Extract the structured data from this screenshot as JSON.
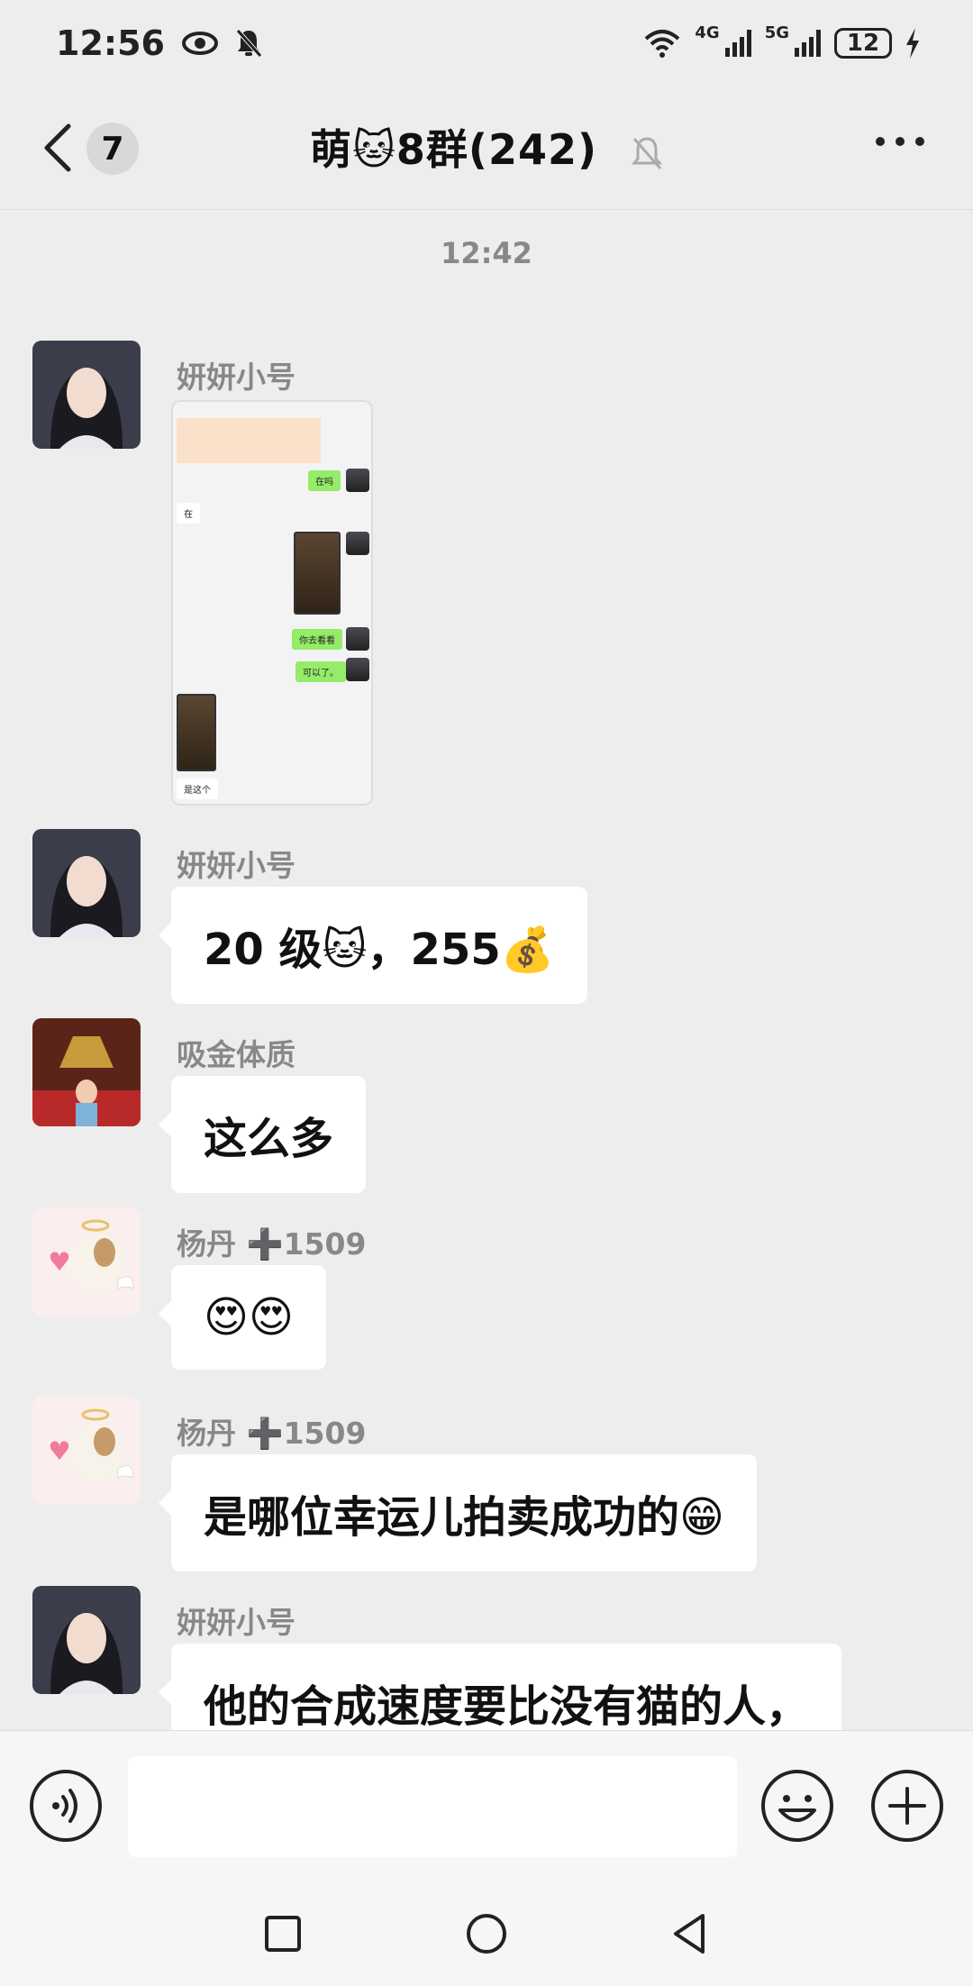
{
  "status_bar": {
    "time": "12:56",
    "net_4g": "4G",
    "net_5g": "5G",
    "battery": "12"
  },
  "header": {
    "unread_count": "7",
    "title": "萌🐱8群(242)"
  },
  "chat": {
    "timestamp": "12:42",
    "messages": [
      {
        "sender": "妍妍小号",
        "type": "image",
        "image_content": {
          "msg_1": "在吗",
          "msg_2": "在",
          "msg_3": "你去看看",
          "msg_4": "可以了。",
          "msg_5": "是这个"
        }
      },
      {
        "sender": "妍妍小号",
        "text": "20 级🐱，255💰"
      },
      {
        "sender": "吸金体质",
        "text": "这么多"
      },
      {
        "sender": "杨丹 ➕1509",
        "text": "😍😍"
      },
      {
        "sender": "杨丹 ➕1509",
        "text": "是哪位幸运儿拍卖成功的😁"
      },
      {
        "sender": "妍妍小号",
        "text": "他的合成速度要比没有猫的人，"
      }
    ]
  },
  "input_bar": {
    "placeholder": ""
  },
  "colors": {
    "background": "#ededed",
    "bubble": "#ffffff",
    "mini_green": "#95ec69"
  }
}
